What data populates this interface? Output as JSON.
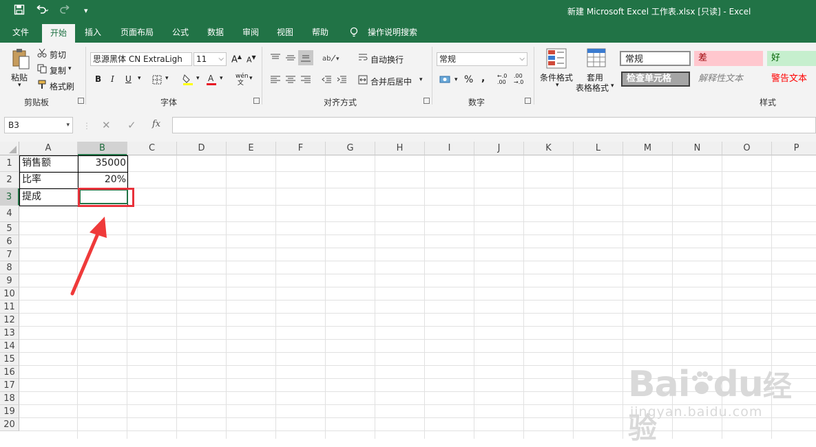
{
  "window": {
    "title": "新建 Microsoft Excel 工作表.xlsx  [只读]  -  Excel"
  },
  "quick_access": {
    "save_icon": "save-icon",
    "undo_icon": "undo-icon",
    "redo_icon": "redo-icon",
    "customize_icon": "chevron-down-icon"
  },
  "tabs": [
    {
      "label": "文件"
    },
    {
      "label": "开始"
    },
    {
      "label": "插入"
    },
    {
      "label": "页面布局"
    },
    {
      "label": "公式"
    },
    {
      "label": "数据"
    },
    {
      "label": "审阅"
    },
    {
      "label": "视图"
    },
    {
      "label": "帮助"
    },
    {
      "label": "操作说明搜索"
    }
  ],
  "ribbon": {
    "clipboard": {
      "paste": "粘贴",
      "cut": "剪切",
      "copy": "复制",
      "format_painter": "格式刷",
      "label": "剪贴板"
    },
    "font": {
      "family": "思源黑体 CN ExtraLigh",
      "size": "11",
      "bold": "B",
      "italic": "I",
      "underline": "U",
      "label": "字体",
      "font_color": "#e81123",
      "fill_color": "#ffff00"
    },
    "alignment": {
      "wrap": "自动换行",
      "merge": "合并后居中",
      "label": "对齐方式"
    },
    "number": {
      "format": "常规",
      "percent": "%",
      "comma": ",",
      "label": "数字",
      "inc_decimal": ".0\n.00",
      "dec_decimal": ".00\n.0"
    },
    "styles": {
      "conditional": "条件格式",
      "table_format_1": "套用",
      "table_format_2": "表格格式",
      "normal": "常规",
      "bad": "差",
      "good": "好",
      "check_cell": "检查单元格",
      "explanatory": "解释性文本",
      "warning": "警告文本",
      "label": "样式"
    }
  },
  "formula_bar": {
    "name_box": "B3",
    "cancel": "✕",
    "enter": "✓",
    "fx": "fx",
    "value": ""
  },
  "columns": [
    "A",
    "B",
    "C",
    "D",
    "E",
    "F",
    "G",
    "H",
    "I",
    "J",
    "K",
    "L",
    "M",
    "N",
    "O",
    "P"
  ],
  "rows": [
    "1",
    "2",
    "3",
    "4",
    "5",
    "6",
    "7",
    "8",
    "9",
    "10",
    "11",
    "12",
    "13",
    "14",
    "15",
    "16",
    "17",
    "18",
    "19",
    "20"
  ],
  "cells": {
    "A1": "销售额",
    "B1": "35000",
    "A2": "比率",
    "B2": "20%",
    "A3": "提成",
    "B3": ""
  },
  "selection": {
    "cell": "B3",
    "highlight_color": "#e8313a",
    "accent": "#217346"
  },
  "watermark": {
    "brand": "Bai",
    "brand2": "du",
    "suffix": "经验",
    "url": "jingyan.baidu.com"
  }
}
